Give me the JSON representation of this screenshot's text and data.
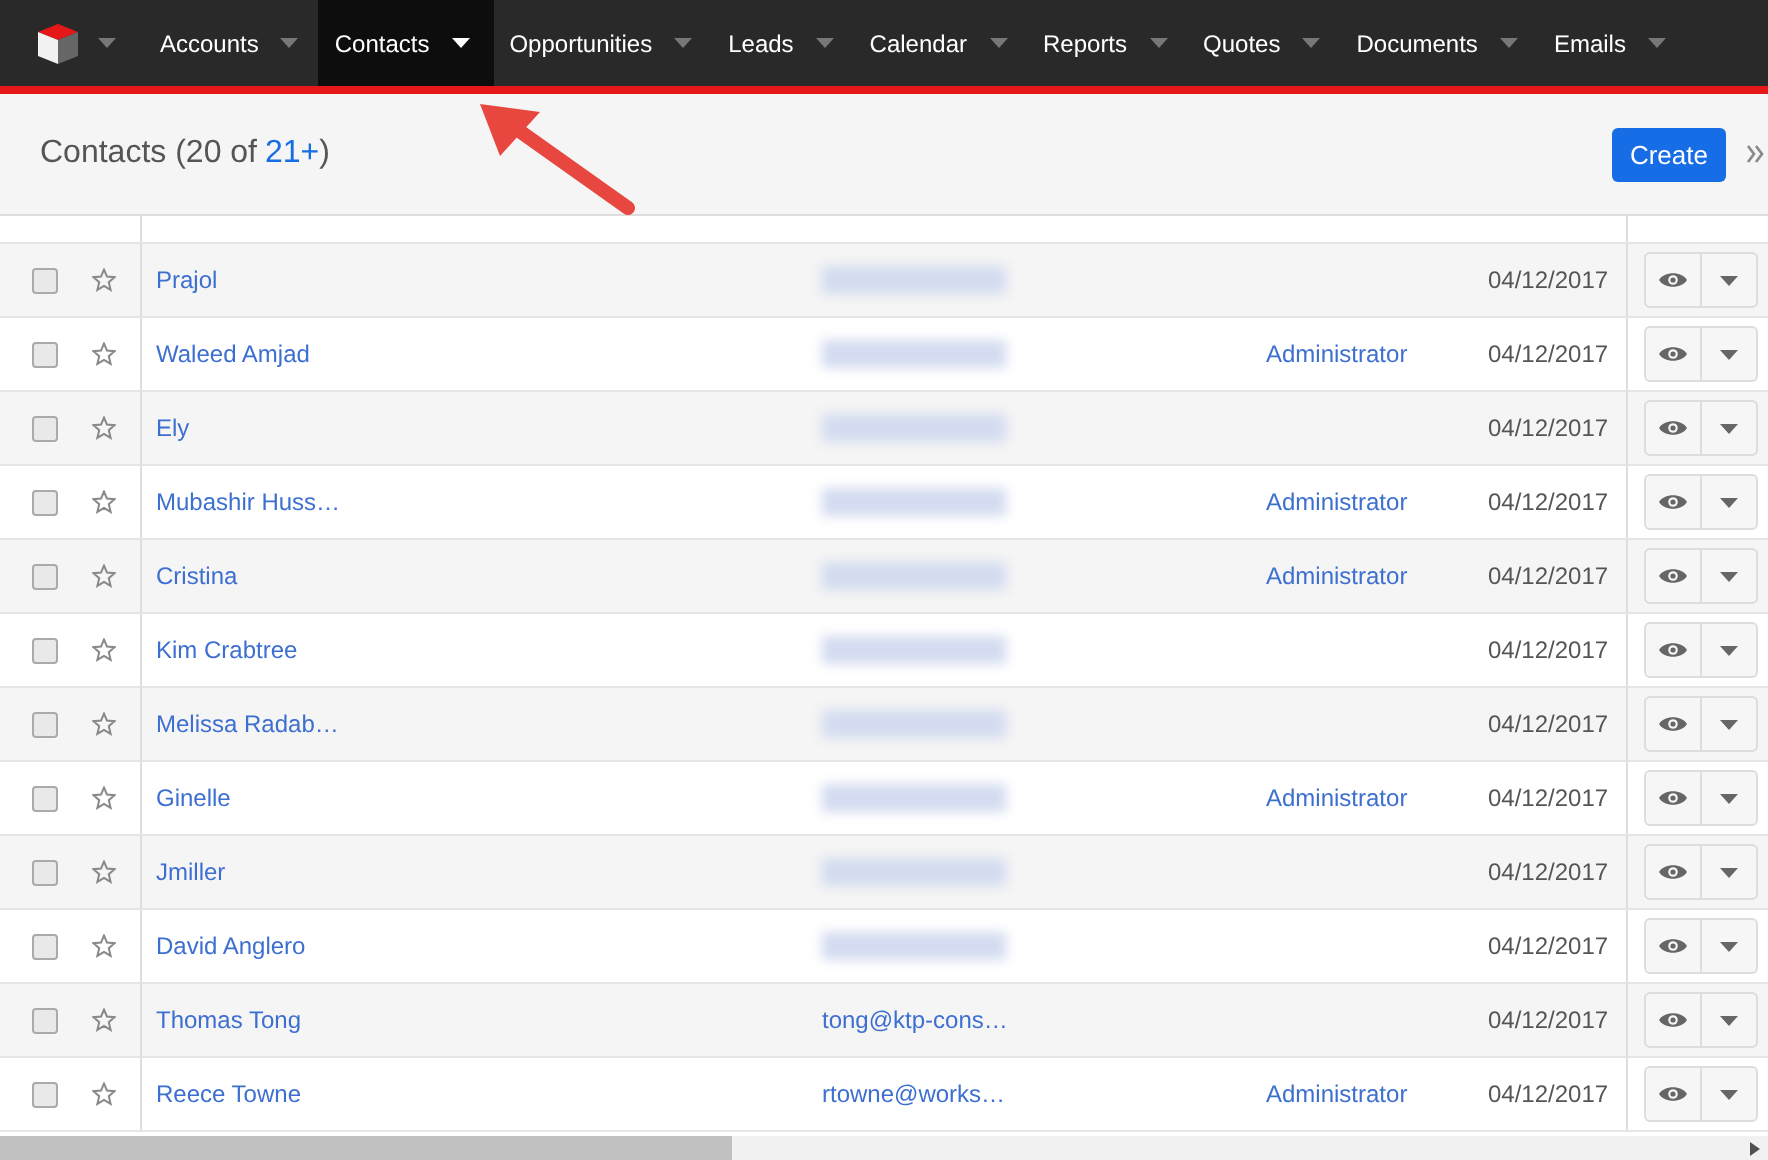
{
  "nav": {
    "items": [
      {
        "label": "Accounts",
        "selected": false
      },
      {
        "label": "Contacts",
        "selected": true
      },
      {
        "label": "Opportunities",
        "selected": false
      },
      {
        "label": "Leads",
        "selected": false
      },
      {
        "label": "Calendar",
        "selected": false
      },
      {
        "label": "Reports",
        "selected": false
      },
      {
        "label": "Quotes",
        "selected": false
      },
      {
        "label": "Documents",
        "selected": false
      },
      {
        "label": "Emails",
        "selected": false
      }
    ]
  },
  "header": {
    "title": "Contacts (20 of",
    "count_link": "21+",
    "title_end": ")",
    "create_button": "Create"
  },
  "table": {
    "rows": [
      {
        "name": "Prajol",
        "checked": false,
        "favorite": false,
        "email_hidden": true,
        "date": "04/12/2017"
      },
      {
        "name": "Waleed Amjad",
        "checked": false,
        "favorite": false,
        "email_hidden": true,
        "user": "Administrator",
        "date": "04/12/2017"
      },
      {
        "name": "Ely",
        "checked": false,
        "favorite": false,
        "email_hidden": true,
        "date": "04/12/2017"
      },
      {
        "name": "Mubashir Huss…",
        "checked": false,
        "favorite": false,
        "email_hidden": true,
        "user": "Administrator",
        "date": "04/12/2017"
      },
      {
        "name": "Cristina",
        "checked": false,
        "favorite": false,
        "email_hidden": true,
        "user": "Administrator",
        "date": "04/12/2017"
      },
      {
        "name": "Kim Crabtree",
        "checked": false,
        "favorite": false,
        "email_hidden": true,
        "date": "04/12/2017"
      },
      {
        "name": "Melissa Radab…",
        "checked": false,
        "favorite": false,
        "email_hidden": true,
        "date": "04/12/2017"
      },
      {
        "name": "Ginelle",
        "checked": false,
        "favorite": false,
        "email_hidden": true,
        "user": "Administrator",
        "date": "04/12/2017"
      },
      {
        "name": "Jmiller",
        "checked": false,
        "favorite": false,
        "email_hidden": true,
        "date": "04/12/2017"
      },
      {
        "name": "David Anglero",
        "checked": false,
        "favorite": false,
        "email_hidden": true,
        "date": "04/12/2017"
      },
      {
        "name": "Thomas Tong",
        "checked": false,
        "favorite": false,
        "email_hidden": false,
        "email": "tong@ktp-cons…",
        "date": "04/12/2017"
      },
      {
        "name": "Reece Towne",
        "checked": false,
        "favorite": false,
        "email_hidden": false,
        "email": "rtowne@works…",
        "user": "Administrator",
        "date": "04/12/2017"
      }
    ]
  }
}
